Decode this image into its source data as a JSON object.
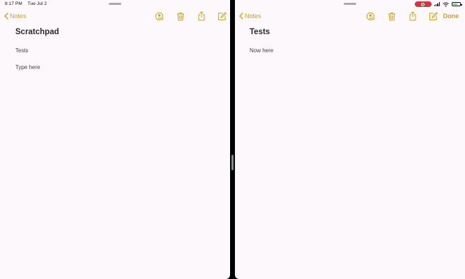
{
  "status_bar": {
    "time": "8:17 PM",
    "date": "Tue Jul 2"
  },
  "colors": {
    "accent": "#c9a227",
    "paper": "#fcf8fb",
    "recording": "#d3353c"
  },
  "left_pane": {
    "back_label": "Notes",
    "toolbar_icons": [
      "add-person-icon",
      "trash-icon",
      "share-icon",
      "compose-icon"
    ],
    "note": {
      "title": "Scratchpad",
      "lines": [
        "Tests",
        "Type here"
      ]
    }
  },
  "right_pane": {
    "back_label": "Notes",
    "done_label": "Done",
    "toolbar_icons": [
      "add-person-icon",
      "trash-icon",
      "share-icon",
      "compose-icon"
    ],
    "note": {
      "title": "Tests",
      "lines": [
        "Now here"
      ]
    }
  }
}
